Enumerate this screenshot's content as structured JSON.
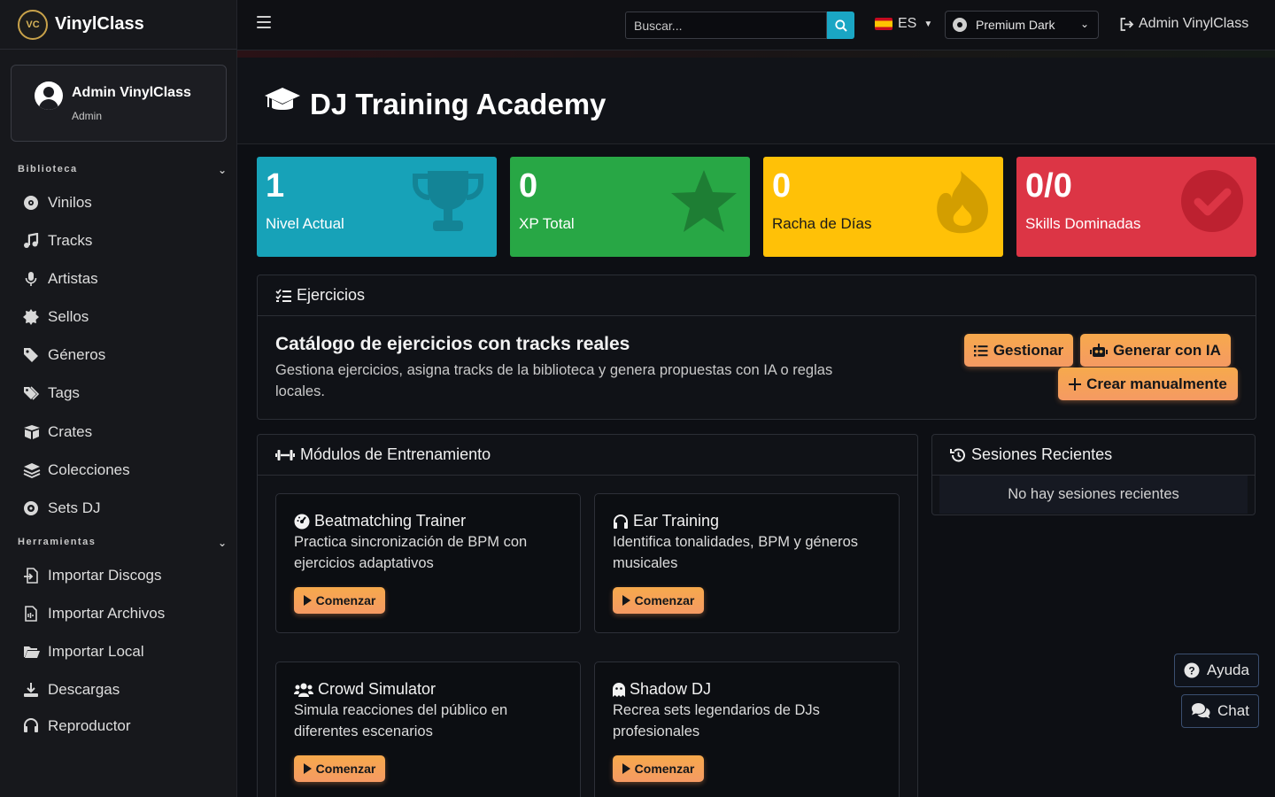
{
  "app": {
    "brand_name": "VinylClass",
    "logo_text": "VC"
  },
  "user": {
    "name": "Admin VinylClass",
    "role": "Admin"
  },
  "sidebar": {
    "sections": [
      {
        "title": "Biblioteca"
      },
      {
        "title": "Herramientas"
      }
    ],
    "library_items": [
      {
        "label": "Vinilos",
        "icon": "disc-icon"
      },
      {
        "label": "Tracks",
        "icon": "music-icon"
      },
      {
        "label": "Artistas",
        "icon": "microphone-icon"
      },
      {
        "label": "Sellos",
        "icon": "certificate-icon"
      },
      {
        "label": "Géneros",
        "icon": "tag-icon"
      },
      {
        "label": "Tags",
        "icon": "tags-icon"
      },
      {
        "label": "Crates",
        "icon": "box-icon"
      },
      {
        "label": "Colecciones",
        "icon": "layers-icon"
      },
      {
        "label": "Sets DJ",
        "icon": "record-icon"
      }
    ],
    "tool_items": [
      {
        "label": "Importar Discogs",
        "icon": "file-import-icon"
      },
      {
        "label": "Importar Archivos",
        "icon": "file-audio-icon"
      },
      {
        "label": "Importar Local",
        "icon": "folder-open-icon"
      },
      {
        "label": "Descargas",
        "icon": "download-icon"
      },
      {
        "label": "Reproductor",
        "icon": "headphones-icon"
      }
    ]
  },
  "topbar": {
    "search_placeholder": "Buscar...",
    "language": "ES",
    "theme": "Premium Dark",
    "account": "Admin VinylClass"
  },
  "page": {
    "title": "DJ Training Academy"
  },
  "stats": [
    {
      "value": "1",
      "label": "Nivel Actual",
      "color": "#17a2b8",
      "icon": "trophy-icon"
    },
    {
      "value": "0",
      "label": "XP Total",
      "color": "#28a745",
      "icon": "star-icon"
    },
    {
      "value": "0",
      "label": "Racha de Días",
      "color": "#ffc107",
      "icon": "fire-icon"
    },
    {
      "value": "0/0",
      "label": "Skills Dominadas",
      "color": "#dc3545",
      "icon": "check-circle-icon"
    }
  ],
  "exercises": {
    "header": "Ejercicios",
    "title": "Catálogo de ejercicios con tracks reales",
    "description": "Gestiona ejercicios, asigna tracks de la biblioteca y genera propuestas con IA o reglas locales.",
    "manage_label": "Gestionar",
    "generate_label": "Generar con IA",
    "create_label": "Crear manualmente"
  },
  "modules": {
    "header": "Módulos de Entrenamiento",
    "start_label": "Comenzar",
    "items": [
      {
        "title": "Beatmatching Trainer",
        "description": "Practica sincronización de BPM con ejercicios adaptativos",
        "icon": "gauge-icon"
      },
      {
        "title": "Ear Training",
        "description": "Identifica tonalidades, BPM y géneros musicales",
        "icon": "headphones-icon"
      },
      {
        "title": "Crowd Simulator",
        "description": "Simula reacciones del público en diferentes escenarios",
        "icon": "users-icon"
      },
      {
        "title": "Shadow DJ",
        "description": "Recrea sets legendarios de DJs profesionales",
        "icon": "ghost-icon"
      }
    ]
  },
  "sessions": {
    "header": "Sesiones Recientes",
    "empty": "No hay sesiones recientes"
  },
  "floating": {
    "help_label": "Ayuda",
    "chat_label": "Chat"
  }
}
